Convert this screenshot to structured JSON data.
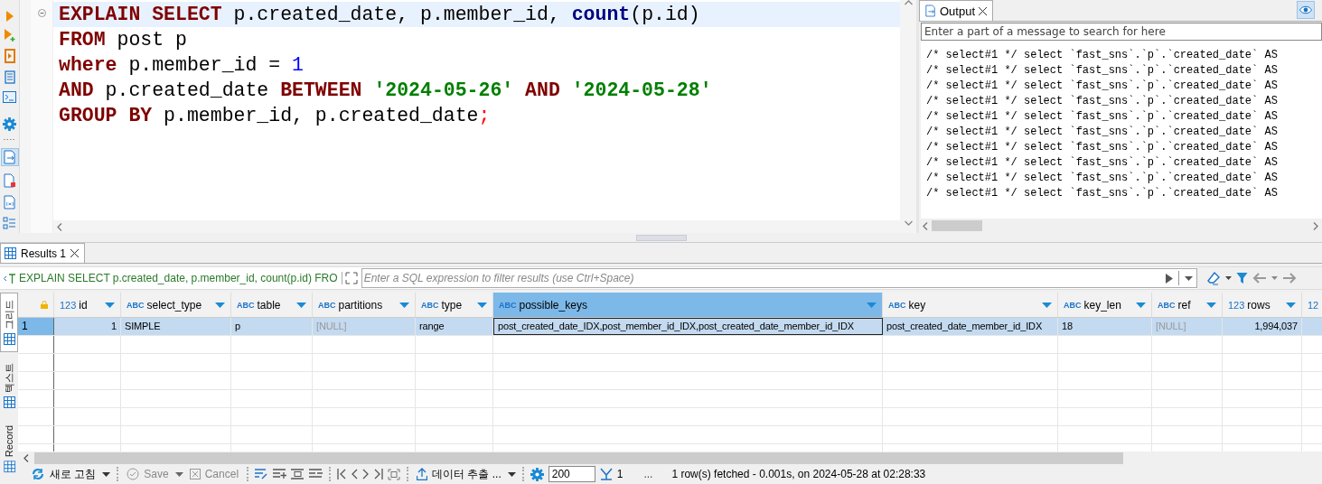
{
  "editor": {
    "lines": [
      {
        "current": true,
        "tokens": [
          {
            "kind": "keyword",
            "text": "EXPLAIN",
            "gap": false
          },
          {
            "kind": "keyword",
            "text": "SELECT",
            "gap": true
          },
          {
            "kind": "plain",
            "text": " p.created_date, p.member_id, ",
            "gap": false
          },
          {
            "kind": "function",
            "text": "count",
            "gap": false
          },
          {
            "kind": "plain",
            "text": "(p.id)",
            "gap": false
          }
        ]
      },
      {
        "current": false,
        "tokens": [
          {
            "kind": "keyword",
            "text": "FROM",
            "gap": false
          },
          {
            "kind": "plain",
            "text": " post p",
            "gap": false
          }
        ]
      },
      {
        "current": false,
        "tokens": [
          {
            "kind": "keyword",
            "text": "where",
            "gap": false
          },
          {
            "kind": "plain",
            "text": " p.member_id = ",
            "gap": false
          },
          {
            "kind": "number",
            "text": "1",
            "gap": false
          }
        ]
      },
      {
        "current": false,
        "tokens": [
          {
            "kind": "keyword",
            "text": "AND",
            "gap": false
          },
          {
            "kind": "plain",
            "text": " p.created_date ",
            "gap": false
          },
          {
            "kind": "keyword",
            "text": "BETWEEN",
            "gap": false
          },
          {
            "kind": "string",
            "text": "'2024-05-26'",
            "gap": true
          },
          {
            "kind": "keyword",
            "text": "AND",
            "gap": true
          },
          {
            "kind": "string",
            "text": "'2024-05-28'",
            "gap": true
          }
        ]
      },
      {
        "current": false,
        "tokens": [
          {
            "kind": "keyword",
            "text": "GROUP BY",
            "gap": false
          },
          {
            "kind": "plain",
            "text": " p.member_id, p.created_date",
            "gap": false
          },
          {
            "kind": "delimiter",
            "text": ";",
            "gap": false
          }
        ]
      }
    ]
  },
  "output": {
    "tab": "Output",
    "eye_toggle": {
      "selected": true
    },
    "search": {
      "placeholder": "Enter a part of a message to search for here"
    },
    "lines": [
      "/* select#1 */ select `fast_sns`.`p`.`created_date` AS",
      "/* select#1 */ select `fast_sns`.`p`.`created_date` AS",
      "/* select#1 */ select `fast_sns`.`p`.`created_date` AS",
      "/* select#1 */ select `fast_sns`.`p`.`created_date` AS",
      "/* select#1 */ select `fast_sns`.`p`.`created_date` AS",
      "/* select#1 */ select `fast_sns`.`p`.`created_date` AS",
      "/* select#1 */ select `fast_sns`.`p`.`created_date` AS",
      "/* select#1 */ select `fast_sns`.`p`.`created_date` AS",
      "/* select#1 */ select `fast_sns`.`p`.`created_date` AS",
      "/* select#1 */ select `fast_sns`.`p`.`created_date` AS"
    ]
  },
  "results": {
    "tab": "Results 1",
    "query": "EXPLAIN SELECT p.created_date, p.member_id, count(p.id) FRO",
    "filter": {
      "placeholder": "Enter a SQL expression to filter results (use Ctrl+Space)"
    },
    "views": [
      {
        "label": "그리드",
        "selected": true
      },
      {
        "label": "텍스트",
        "selected": false
      },
      {
        "label": "Record",
        "selected": false
      }
    ],
    "columns": [
      {
        "type": "123",
        "name": "id",
        "numeric": true,
        "selected": false
      },
      {
        "type": "ABC",
        "name": "select_type",
        "numeric": false,
        "selected": false
      },
      {
        "type": "ABC",
        "name": "table",
        "numeric": false,
        "selected": false
      },
      {
        "type": "ABC",
        "name": "partitions",
        "numeric": false,
        "selected": false
      },
      {
        "type": "ABC",
        "name": "type",
        "numeric": false,
        "selected": false
      },
      {
        "type": "ABC",
        "name": "possible_keys",
        "numeric": false,
        "selected": true
      },
      {
        "type": "ABC",
        "name": "key",
        "numeric": false,
        "selected": false
      },
      {
        "type": "ABC",
        "name": "key_len",
        "numeric": false,
        "selected": false
      },
      {
        "type": "ABC",
        "name": "ref",
        "numeric": false,
        "selected": false
      },
      {
        "type": "123",
        "name": "rows",
        "numeric": true,
        "selected": false
      },
      {
        "type": "12",
        "numeric": true,
        "selected": false
      }
    ],
    "rows": [
      {
        "number": "1",
        "selected": true,
        "cells": [
          {
            "text": "1",
            "null": false
          },
          {
            "text": "SIMPLE",
            "null": false
          },
          {
            "text": "p",
            "null": false
          },
          {
            "text": "[NULL]",
            "null": true
          },
          {
            "text": "range",
            "null": false
          },
          {
            "text": "post_created_date_IDX,post_member_id_IDX,post_created_date_member_id_IDX",
            "null": false
          },
          {
            "text": "post_created_date_member_id_IDX",
            "null": false
          },
          {
            "text": "18",
            "null": false
          },
          {
            "text": "[NULL]",
            "null": true
          },
          {
            "text": "1,994,037",
            "null": false
          }
        ]
      }
    ]
  },
  "toolbar": {
    "refresh": {
      "label": "새로 고침"
    },
    "save": {
      "label": "Save",
      "disabled": true
    },
    "cancel": {
      "label": "Cancel",
      "disabled": true
    },
    "export": {
      "label": "데이터 추출 ..."
    },
    "fetch_size": {
      "value": "200"
    },
    "fetch_count": "1",
    "more": "...",
    "status": "1 row(s) fetched - 0.001s, on 2024-05-28 at 02:28:33"
  }
}
